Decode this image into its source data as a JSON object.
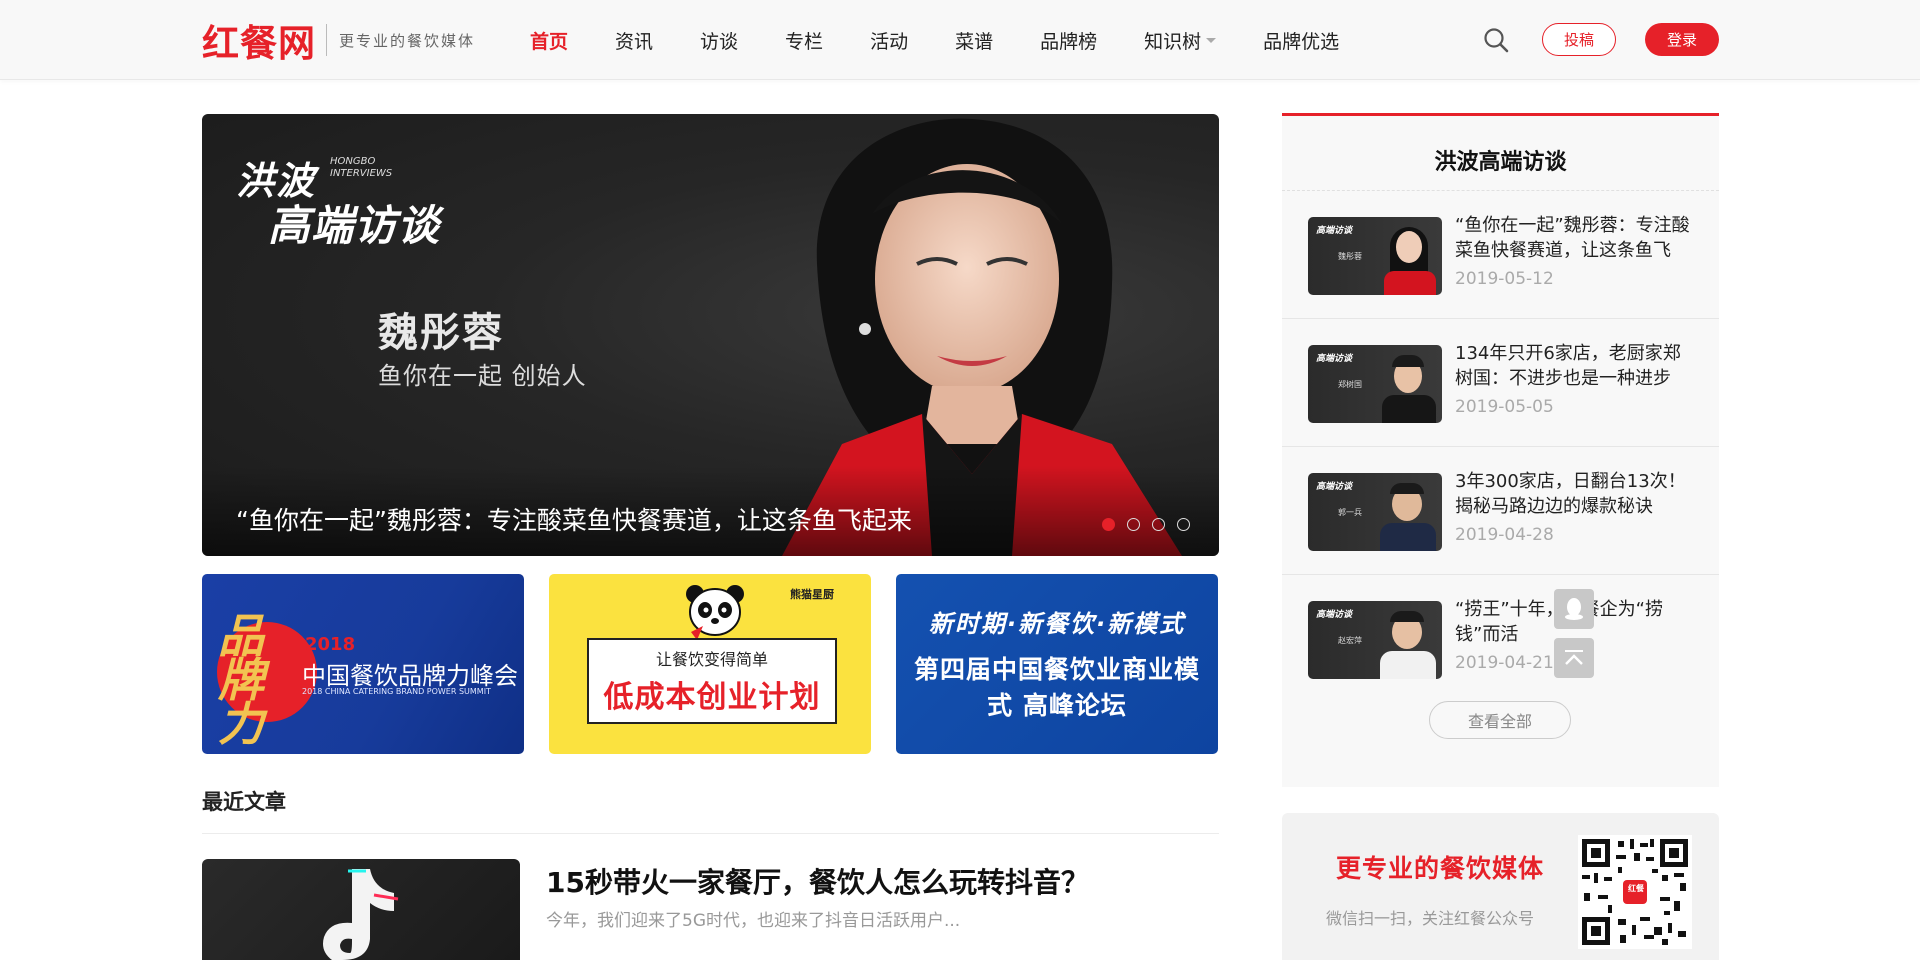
{
  "brand": {
    "logo_text": "红餐网",
    "slogan": "更专业的餐饮媒体"
  },
  "nav": {
    "items": [
      {
        "label": "首页",
        "active": true
      },
      {
        "label": "资讯"
      },
      {
        "label": "访谈"
      },
      {
        "label": "专栏"
      },
      {
        "label": "活动"
      },
      {
        "label": "菜谱"
      },
      {
        "label": "品牌榜"
      },
      {
        "label": "知识树",
        "has_dropdown": true
      },
      {
        "label": "品牌优选"
      }
    ],
    "search_icon": "search-icon",
    "submit_label": "投稿",
    "login_label": "登录"
  },
  "hero": {
    "brand_line1": "洪波",
    "brand_en": "HONGBO\nINTERVIEWS",
    "brand_line2": "高端访谈",
    "person_name": "魏彤蓉",
    "person_role": "鱼你在一起 创始人",
    "caption": "“鱼你在一起”魏彤蓉：专注酸菜鱼快餐赛道，让这条鱼飞起来",
    "dots": 4,
    "active_dot": 0
  },
  "banners": [
    {
      "big": "品牌力",
      "year": "2018",
      "title": "中国餐饮品牌力峰会",
      "subtitle": "2018 CHINA CATERING BRAND POWER SUMMIT"
    },
    {
      "tag": "熊猫星厨",
      "line1": "让餐饮变得简单",
      "line2": "低成本创业计划"
    },
    {
      "top": "新时期·新餐饮·新模式",
      "title": "第四届中国餐饮业商业模式 高峰论坛"
    }
  ],
  "recent": {
    "heading": "最近文章",
    "article": {
      "title": "15秒带火一家餐厅，餐饮人怎么玩转抖音？",
      "excerpt": "今年，我们迎来了5G时代，也迎来了抖音日活跃用户..."
    }
  },
  "sidebar": {
    "title": "洪波高端访谈",
    "items": [
      {
        "text": "“鱼你在一起”魏彤蓉：专注酸菜鱼快餐赛道，让这条鱼飞",
        "date": "2019-05-12",
        "thumb_name": "魏彤蓉"
      },
      {
        "text": "134年只开6家店，老厨家郑树国：不进步也是一种进步",
        "date": "2019-05-05",
        "thumb_name": "郑树国"
      },
      {
        "text": "3年300家店，日翻台13次！揭秘马路边边的爆款秘诀",
        "date": "2019-04-28",
        "thumb_name": "郭一兵"
      },
      {
        "text": "“捞王”十年，愿餐企为“捞钱”而活",
        "date": "2019-04-21",
        "thumb_name": "赵宏萍"
      }
    ],
    "view_all": "查看全部",
    "qr": {
      "slogan": "更专业的餐饮媒体",
      "hint": "微信扫一扫，关注红餐公众号",
      "badge": "红餐"
    }
  },
  "colors": {
    "accent": "#e62129"
  }
}
